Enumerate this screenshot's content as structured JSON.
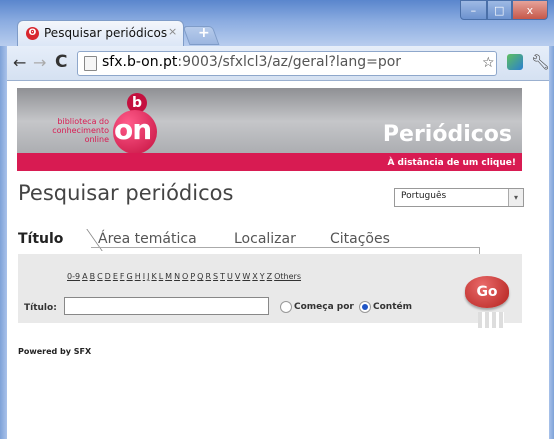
{
  "browser": {
    "tab_title": "Pesquisar periódicos",
    "tab_close": "×",
    "new_tab": "+",
    "url_host": "sfx.b-on.pt",
    "url_rest": ":9003/sfxlcl3/az/geral?lang=por",
    "window_buttons": {
      "minimize": "–",
      "maximize": "□",
      "close": "x"
    }
  },
  "banner": {
    "logo_text_line1": "biblioteca do",
    "logo_text_line2": "conhecimento online",
    "logo_b": "b",
    "logo_on": "on",
    "title": "Periódicos",
    "tagline": "À distância de um clique!"
  },
  "page": {
    "heading": "Pesquisar periódicos",
    "language": "Português"
  },
  "tabs": [
    {
      "label": "Título",
      "active": true
    },
    {
      "label": "Área temática"
    },
    {
      "label": "Localizar"
    },
    {
      "label": "Citações"
    }
  ],
  "alphabet": [
    "0-9",
    "A",
    "B",
    "C",
    "D",
    "E",
    "F",
    "G",
    "H",
    "I",
    "J",
    "K",
    "L",
    "M",
    "N",
    "O",
    "P",
    "Q",
    "R",
    "S",
    "T",
    "U",
    "V",
    "W",
    "X",
    "Y",
    "Z",
    "Others"
  ],
  "form": {
    "title_label": "Título:",
    "title_value": "",
    "radio_begins": "Começa por",
    "radio_contains": "Contém",
    "go": "Go"
  },
  "footer": {
    "powered": "Powered by SFX"
  }
}
